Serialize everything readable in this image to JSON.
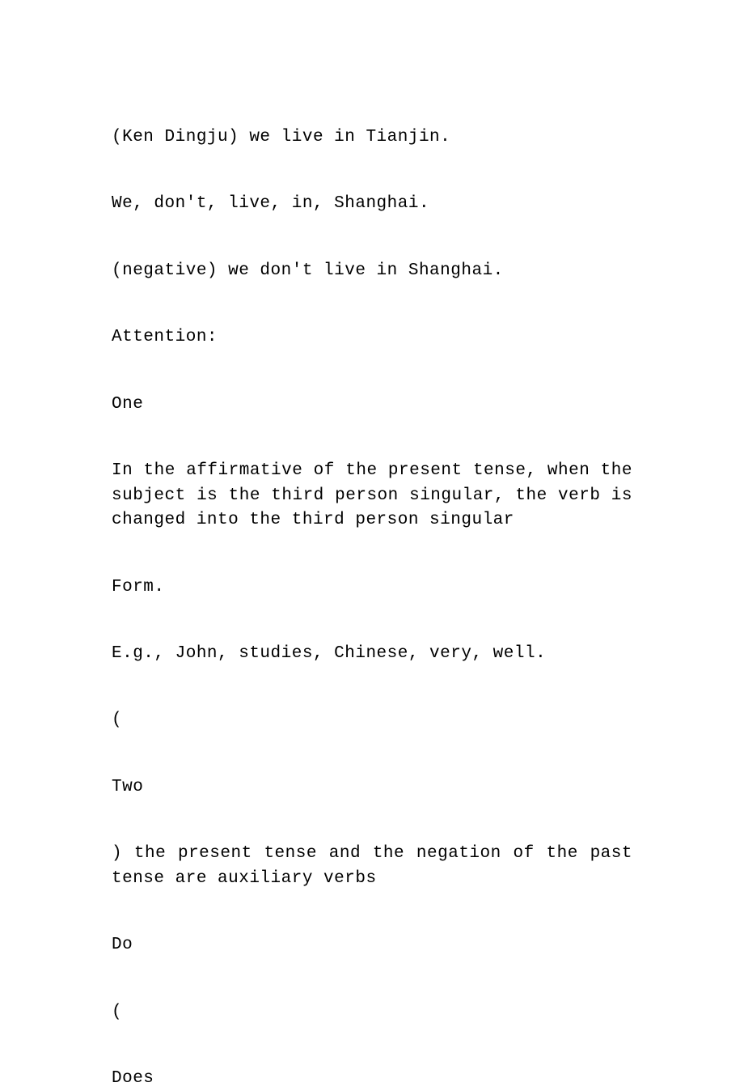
{
  "paragraphs": [
    "(Ken Dingju) we live in Tianjin.",
    "We, don't, live, in, Shanghai.",
    "(negative) we don't live in Shanghai.",
    "Attention:",
    "One",
    "In the affirmative of the present tense, when the subject is the third person singular, the verb is changed into the third person singular",
    "Form.",
    "E.g., John, studies, Chinese, very, well.",
    "(",
    "Two",
    ") the present tense and the negation of the past tense are auxiliary verbs",
    "Do",
    "(",
    "Does"
  ]
}
